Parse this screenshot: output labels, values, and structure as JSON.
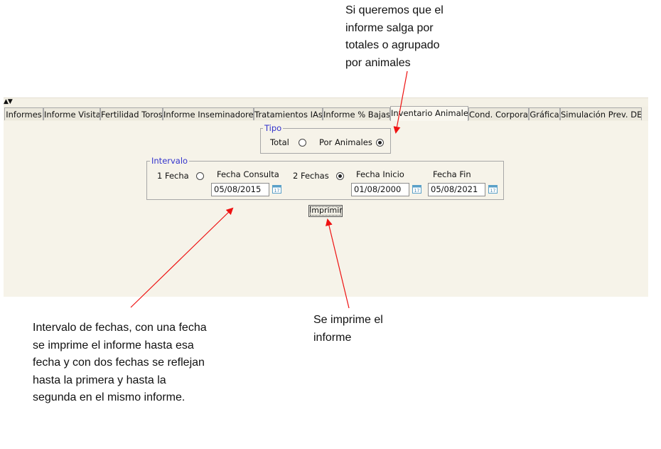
{
  "annotations": {
    "tipo_note": "Si queremos que el\ninforme salga por\ntotales o agrupado\npor animales",
    "intervalo_note": "Intervalo de fechas, con una fecha\nse imprime el informe hasta esa\nfecha y con dos fechas se reflejan\nhasta la primera y hasta la\nsegunda en el mismo informe.",
    "imprimir_note": "Se imprime el\ninforme",
    "arrow_color": "#ee1111"
  },
  "tabs": [
    {
      "label": "Informes"
    },
    {
      "label": "Informe Visita"
    },
    {
      "label": "Fertilidad Toros"
    },
    {
      "label": "Informe Inseminadores"
    },
    {
      "label": "Tratamientos IAs"
    },
    {
      "label": "Informe % Bajas"
    },
    {
      "label": "Inventario Animales",
      "active": true
    },
    {
      "label": "Cond. Corporal"
    },
    {
      "label": "Gráfica"
    },
    {
      "label": "Simulación Prev. DEL"
    }
  ],
  "tipo": {
    "legend": "Tipo",
    "option_total": "Total",
    "option_animales": "Por Animales",
    "selected": "Por Animales"
  },
  "intervalo": {
    "legend": "Intervalo",
    "option_1fecha": "1 Fecha",
    "option_2fechas": "2 Fechas",
    "selected": "2 Fechas",
    "fecha_consulta_label": "Fecha Consulta",
    "fecha_consulta_value": "05/08/2015",
    "fecha_inicio_label": "Fecha Inicio",
    "fecha_inicio_value": "01/08/2000",
    "fecha_fin_label": "Fecha Fin",
    "fecha_fin_value": "05/08/2021",
    "calendar_icon_text": "17"
  },
  "actions": {
    "print_label": "Imprimir"
  },
  "colors": {
    "legend_text": "#3333cc",
    "panel_bg": "#f6f3e9",
    "calendar_icon": "#5aa0c8"
  }
}
